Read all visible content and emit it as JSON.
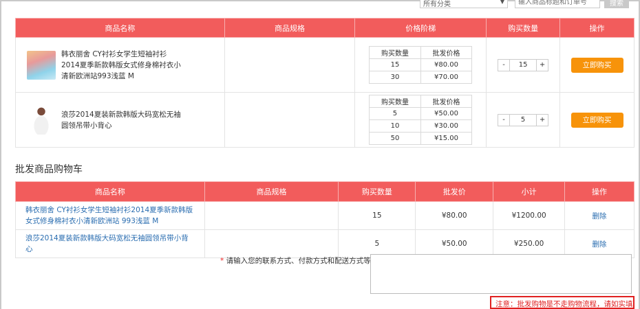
{
  "search": {
    "category_value": "所有分类",
    "placeholder": "输入商品标题和订单号",
    "button_label": "搜索"
  },
  "product_table": {
    "headers": [
      "商品名称",
      "商品规格",
      "价格阶梯",
      "购买数量",
      "操作"
    ],
    "tier_headers": [
      "购买数量",
      "批发价格"
    ],
    "buy_label": "立即购买",
    "products": [
      {
        "name": "韩衣丽舍 CY衬衫女学生短袖衬衫2014夏季新款韩版女式修身棉衬衣小清新欧洲站993浅蓝 M",
        "tiers": [
          [
            "15",
            "¥80.00"
          ],
          [
            "30",
            "¥70.00"
          ]
        ],
        "quantity": "15"
      },
      {
        "name": "浪莎2014夏装新款韩版大码宽松无袖圆领吊带小背心",
        "tiers": [
          [
            "5",
            "¥50.00"
          ],
          [
            "10",
            "¥30.00"
          ],
          [
            "50",
            "¥15.00"
          ]
        ],
        "quantity": "5"
      }
    ]
  },
  "cart": {
    "title": "批发商品购物车",
    "headers": [
      "商品名称",
      "商品规格",
      "购买数量",
      "批发价",
      "小计",
      "操作"
    ],
    "delete_label": "删除",
    "rows": [
      {
        "name": "韩衣丽舍 CY衬衫女学生短袖衬衫2014夏季新款韩版女式修身棉衬衣小清新欧洲站 993浅蓝 M",
        "spec": "",
        "qty": "15",
        "price": "¥80.00",
        "subtotal": "¥1200.00"
      },
      {
        "name": "浪莎2014夏装新款韩版大码宽松无袖圆领吊带小背心",
        "spec": "",
        "qty": "5",
        "price": "¥50.00",
        "subtotal": "¥250.00"
      }
    ]
  },
  "contact": {
    "required_mark": "*",
    "label": "请输入您的联系方式、付款方式和配送方式等信息:"
  },
  "notice": "注意：批发购物是不走购物流程，请如实填写信息"
}
